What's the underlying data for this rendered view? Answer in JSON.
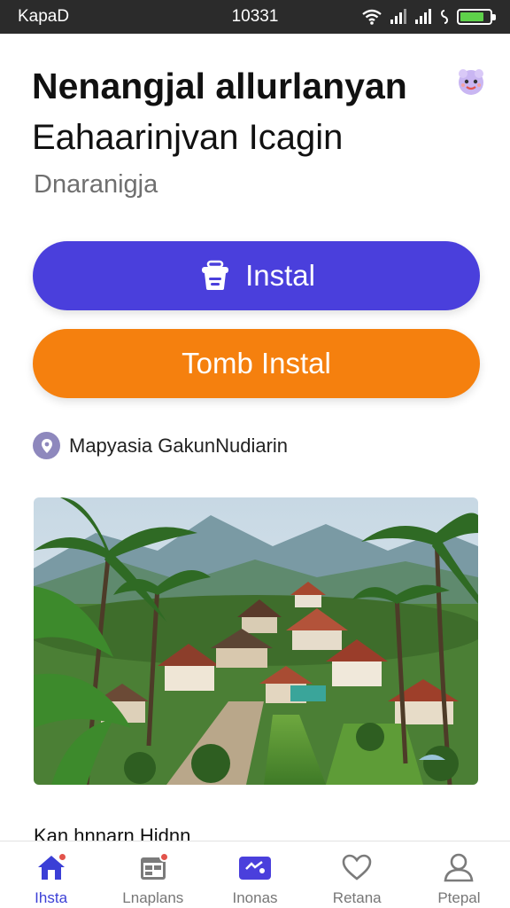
{
  "status_bar": {
    "carrier": "KapaD",
    "time": "10331",
    "battery_level": 0.8
  },
  "header": {
    "title_line_1": "Nenangjal allurlanyan",
    "title_line_2": "Eahaarinjvan Icagin",
    "subtitle": "Dnaranigja"
  },
  "actions": {
    "primary_label": "Instal",
    "secondary_label": "Tomb Instal"
  },
  "location": {
    "text": "Mapyasia GakunNudiarin"
  },
  "section": {
    "heading": "Kan hnnarn Hidnn"
  },
  "bottom_nav": {
    "items": [
      {
        "label": "Ihsta",
        "icon": "home-icon",
        "active": true,
        "badge": true
      },
      {
        "label": "Lnaplans",
        "icon": "calendar-icon",
        "active": false,
        "badge": true
      },
      {
        "label": "Inonas",
        "icon": "ticket-icon",
        "active": false,
        "badge": false
      },
      {
        "label": "Retana",
        "icon": "heart-icon",
        "active": false,
        "badge": false
      },
      {
        "label": "Ptepal",
        "icon": "profile-icon",
        "active": false,
        "badge": false
      }
    ]
  },
  "colors": {
    "primary": "#4a3fdc",
    "secondary": "#f5800e",
    "nav_active": "#3b3fd6"
  }
}
